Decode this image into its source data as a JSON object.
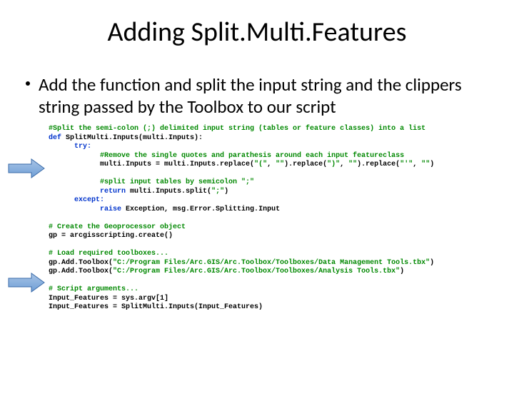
{
  "title": "Adding Split.Multi.Features",
  "bullet": "Add the function and split the input string and the clippers string passed by the Toolbox to our script",
  "code": {
    "c1": "#Split the semi-colon (;) delimited input string (tables or feature classes) into a list",
    "l2_def": "def",
    "l2_name": "SplitMulti.Inputs(multi.Inputs):",
    "l3_try": "try:",
    "c4": "#Remove the single quotes and parathesis around each input featureclass",
    "l5": "multi.Inputs = multi.Inputs.replace(",
    "l7": "#split input tables by semicolon \";\"",
    "l8_ret": "return",
    "l8_rest": " multi.Inputs.split(",
    "l9_exc": "except:",
    "l10_raise": "raise",
    "l10_rest": " Exception, msg.Error.Splitting.Input",
    "c11": "# Create the Geoprocessor object",
    "l12": "gp = arcgisscripting.create()",
    "c13": "# Load required toolboxes...",
    "l14": "gp.Add.Toolbox(",
    "l15": "gp.Add.Toolbox(",
    "c16": "# Script arguments...",
    "l17": "Input_Features = sys.argv[1]",
    "l18": "Input_Features = SplitMulti.Inputs(Input_Features)",
    "s_open": "\"(\"",
    "s_empty": "\"\"",
    "s_close": ").replace(",
    "s_cp": "\")\"",
    "s_q": "\"'\"",
    "s_end": ")",
    "s_sc": "\";\"",
    "p1": "\"C:/Program Files/Arc.GIS/Arc.Toolbox/Toolboxes/Data Management Tools.tbx\"",
    "p2": "\"C:/Program Files/Arc.GIS/Arc.Toolbox/Toolboxes/Analysis Tools.tbx\""
  }
}
